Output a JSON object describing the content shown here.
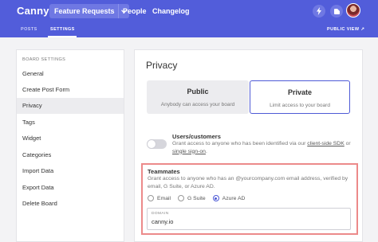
{
  "topbar": {
    "logo": "Canny",
    "board_select": "Feature Requests",
    "nav_people": "People",
    "nav_changelog": "Changelog",
    "icons": [
      "lightning-icon",
      "notifications-icon",
      "avatar"
    ],
    "bg_color": "#525dda"
  },
  "subnav": {
    "tabs": [
      {
        "label": "POSTS",
        "active": false
      },
      {
        "label": "SETTINGS",
        "active": true
      }
    ],
    "public_view": "PUBLIC VIEW ↗"
  },
  "sidebar": {
    "heading": "BOARD SETTINGS",
    "items": [
      {
        "label": "General",
        "active": false
      },
      {
        "label": "Create Post Form",
        "active": false
      },
      {
        "label": "Privacy",
        "active": true
      },
      {
        "label": "Tags",
        "active": false
      },
      {
        "label": "Widget",
        "active": false
      },
      {
        "label": "Categories",
        "active": false
      },
      {
        "label": "Import Data",
        "active": false
      },
      {
        "label": "Export Data",
        "active": false
      },
      {
        "label": "Delete Board",
        "active": false
      }
    ]
  },
  "main": {
    "title": "Privacy",
    "public": {
      "title": "Public",
      "subtitle": "Anybody can access your board"
    },
    "private": {
      "title": "Private",
      "subtitle": "Limit access to your board",
      "selected": true
    },
    "users_customers": {
      "title": "Users/customers",
      "desc_1": "Grant access to anyone who has been identified via our",
      "link_sdk": "client-side SDK",
      "desc_or": "or",
      "link_sso": "single sign-on",
      "desc_end": ".",
      "enabled": false
    },
    "teammates": {
      "title": "Teammates",
      "desc": "Grant access to anyone who has an @yourcompany.com email address, verified by email, G Suite, or Azure AD.",
      "radio_email": "Email",
      "radio_gsuite": "G Suite",
      "radio_azure": "Azure AD",
      "selected": "Azure AD",
      "domain_label": "DOMAIN",
      "domain_value": "canny.io"
    }
  },
  "colors": {
    "accent": "#4e5ad6",
    "highlight_border": "#ec8a8a"
  }
}
